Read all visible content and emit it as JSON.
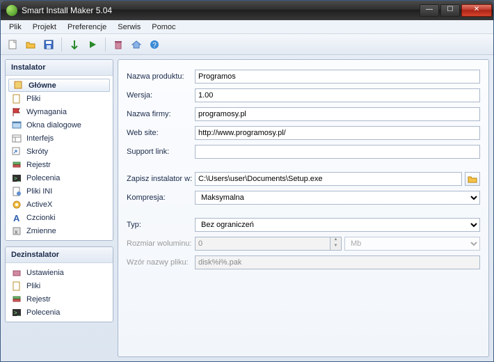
{
  "window": {
    "title": "Smart Install Maker 5.04"
  },
  "menu": [
    "Plik",
    "Projekt",
    "Preferencje",
    "Serwis",
    "Pomoc"
  ],
  "sidebar": {
    "installer": {
      "title": "Instalator",
      "items": [
        {
          "label": "Główne",
          "icon": "home"
        },
        {
          "label": "Pliki",
          "icon": "file"
        },
        {
          "label": "Wymagania",
          "icon": "flag"
        },
        {
          "label": "Okna dialogowe",
          "icon": "dialog"
        },
        {
          "label": "Interfejs",
          "icon": "interface"
        },
        {
          "label": "Skróty",
          "icon": "shortcut"
        },
        {
          "label": "Rejestr",
          "icon": "registry"
        },
        {
          "label": "Polecenia",
          "icon": "command"
        },
        {
          "label": "Pliki INI",
          "icon": "ini"
        },
        {
          "label": "ActiveX",
          "icon": "activex"
        },
        {
          "label": "Czcionki",
          "icon": "font"
        },
        {
          "label": "Zmienne",
          "icon": "vars"
        }
      ]
    },
    "uninstaller": {
      "title": "Dezinstalator",
      "items": [
        {
          "label": "Ustawienia",
          "icon": "settings"
        },
        {
          "label": "Pliki",
          "icon": "file"
        },
        {
          "label": "Rejestr",
          "icon": "registry"
        },
        {
          "label": "Polecenia",
          "icon": "command"
        }
      ]
    }
  },
  "form": {
    "product_label": "Nazwa produktu:",
    "product_value": "Programos",
    "version_label": "Wersja:",
    "version_value": "1.00",
    "company_label": "Nazwa firmy:",
    "company_value": "programosy.pl",
    "website_label": "Web site:",
    "website_value": "http://www.programosy.pl/",
    "support_label": "Support link:",
    "support_value": "",
    "savepath_label": "Zapisz instalator w:",
    "savepath_value": "C:\\Users\\user\\Documents\\Setup.exe",
    "compression_label": "Kompresja:",
    "compression_value": "Maksymalna",
    "type_label": "Typ:",
    "type_value": "Bez ograniczeń",
    "volsize_label": "Rozmiar woluminu:",
    "volsize_value": "0",
    "volsize_unit": "Mb",
    "filenamepat_label": "Wzór nazwy pliku:",
    "filenamepat_value": "disk%i%.pak"
  }
}
